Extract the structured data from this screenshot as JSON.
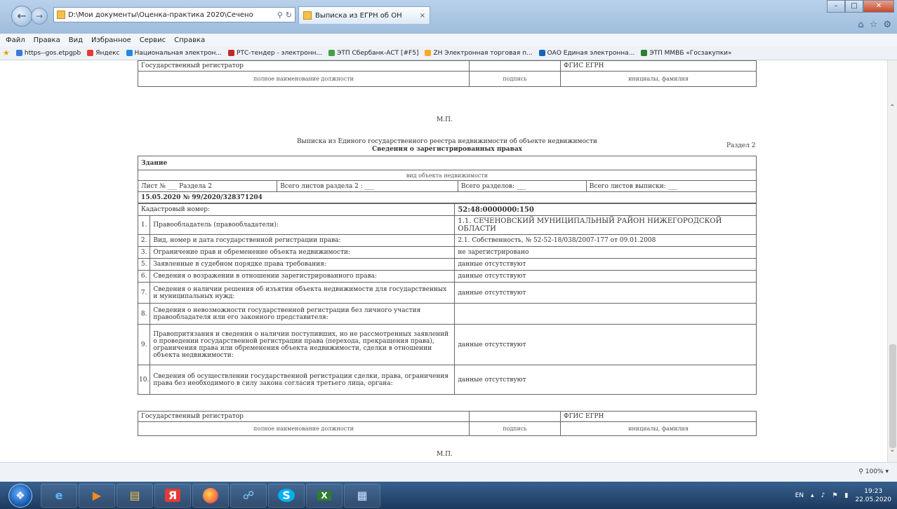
{
  "browser": {
    "address": "D:\\Мои документы\\Оценка-практика 2020\\Сечено",
    "tab_title": "Выписка из ЕГРН об ОН",
    "menu": [
      "Файл",
      "Правка",
      "Вид",
      "Избранное",
      "Сервис",
      "Справка"
    ],
    "favorites": [
      {
        "label": "https--gos.etpgpb",
        "color": "#3a7bd5"
      },
      {
        "label": "Яндекс",
        "color": "#e53935"
      },
      {
        "label": "Национальная электрон...",
        "color": "#1e88e5"
      },
      {
        "label": "РТС-тендер - электронн...",
        "color": "#c62828"
      },
      {
        "label": "ЭТП Сбербанк-АСТ [#F5]",
        "color": "#43a047"
      },
      {
        "label": "ZH Электронная торговая п...",
        "color": "#f9a825"
      },
      {
        "label": "ОАО Единая электронна...",
        "color": "#1565c0"
      },
      {
        "label": "ЭТП ММВБ «Госзакупки»",
        "color": "#2e7d32"
      }
    ],
    "zoom": "100%"
  },
  "doc": {
    "top_sig": {
      "registrar": "Государственный регистратор",
      "fgis": "ФГИС ЕГРН",
      "caption_position": "полное наименование должности",
      "caption_signature": "подпись",
      "caption_initials": "инициалы, фамилия",
      "mp": "М.П."
    },
    "razdel": "Раздел 2",
    "title": "Выписка из Единого государственного реестра недвижимости об объекте недвижимости",
    "subtitle": "Сведения о зарегистрированных правах",
    "object_type": "Здание",
    "object_type_caption": "вид объекта недвижимости",
    "list_no": "Лист № ___ Раздела 2",
    "sheets_in_section": "Всего листов раздела 2 : ___",
    "sections_total": "Всего разделов: ___",
    "sheets_total": "Всего листов выписки: ___",
    "date_number": "15.05.2020   №   99/2020/328371204",
    "cadastral_label": "Кадастровый номер:",
    "cadastral_value": "52:48:0000000:150",
    "rows": [
      {
        "num": "1.",
        "label": "Правообладатель (правообладатели):",
        "value": "1.1. СЕЧЕНОВСКИЙ МУНИЦИПАЛЬНЫЙ РАЙОН НИЖЕГОРОДСКОЙ ОБЛАСТИ"
      },
      {
        "num": "2.",
        "label": "Вид, номер и дата государственной регистрации права:",
        "value": "2.1. Собственность, № 52-52-18/038/2007-177 от 09.01.2008"
      },
      {
        "num": "3.",
        "label": "Ограничение прав и обременение объекта недвижимости:",
        "value": "не зарегистрировано"
      },
      {
        "num": "5.",
        "label": "Заявленные в судебном порядке права требования:",
        "value": "данные отсутствуют"
      },
      {
        "num": "6.",
        "label": "Сведения о возражении в отношении зарегистрированного права:",
        "value": "данные отсутствуют"
      },
      {
        "num": "7.",
        "label": "Сведения о наличии решения об изъятии объекта недвижимости для государственных и муниципальных нужд:",
        "value": "данные отсутствуют"
      },
      {
        "num": "8.",
        "label": "Сведения о невозможности государственной регистрации без личного участия правообладателя или его законного представителя:",
        "value": ""
      },
      {
        "num": "9.",
        "label": "Правопритязания и сведения о наличии поступивших, но не рассмотренных заявлений о проведении государственной регистрации права (перехода, прекращения права), ограничения права или обременения объекта недвижимости, сделки в отношении объекта недвижимости:",
        "value": "данные отсутствуют"
      },
      {
        "num": "10.",
        "label": "Сведения об осуществлении государственной регистрации сделки, права, ограничения права без необходимого в силу закона согласия третьего лица, органа:",
        "value": "данные отсутствуют"
      }
    ],
    "bottom_sig": {
      "registrar": "Государственный регистратор",
      "fgis": "ФГИС ЕГРН",
      "caption_position": "полное наименование должности",
      "caption_signature": "подпись",
      "caption_initials": "инициалы, фамилия",
      "mp": "М.П."
    }
  },
  "tray": {
    "lang": "EN",
    "time": "19:23",
    "date": "22.05.2020"
  },
  "taskbar": {
    "yandex_label": "Я",
    "skype_label": "S"
  }
}
